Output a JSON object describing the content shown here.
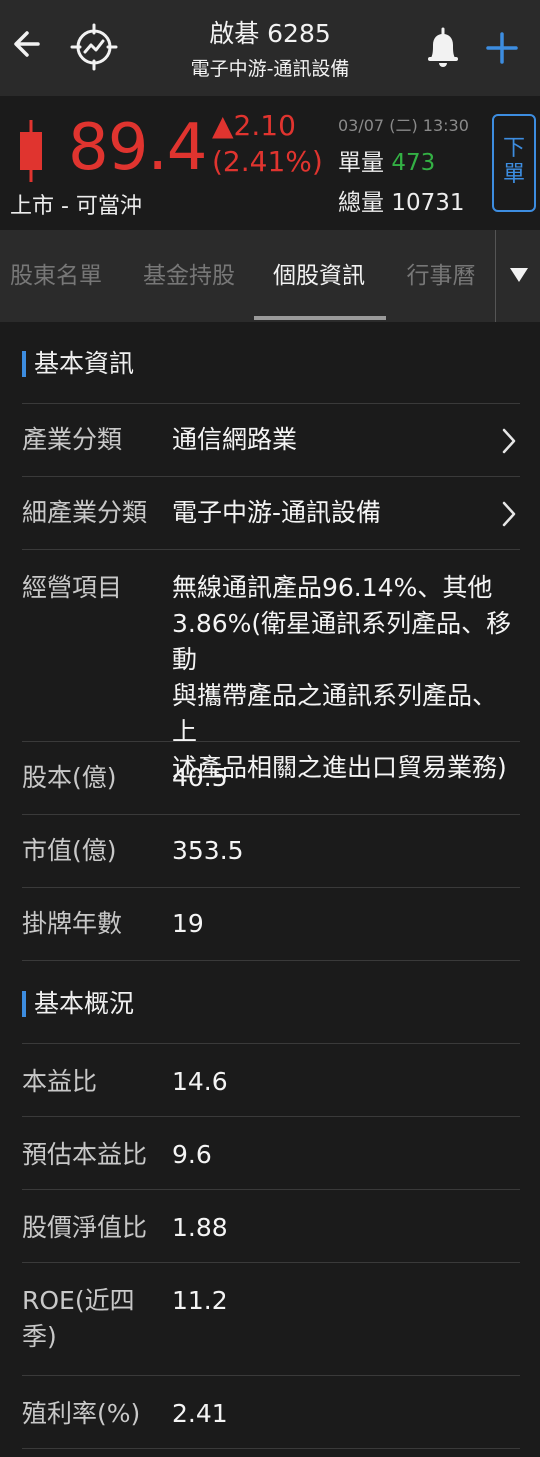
{
  "header": {
    "title": "啟碁 6285",
    "subtitle": "電子中游-通訊設備"
  },
  "quote": {
    "price": "89.4",
    "change": "▲2.10",
    "change_pct": "(2.41%)",
    "status": "上市 - 可當沖",
    "datetime": "03/07 (二) 13:30",
    "single_label": "單量",
    "single_value": "473",
    "total_label": "總量",
    "total_value": "10731",
    "order_button": "下單"
  },
  "tabs": [
    {
      "label": "股東名單"
    },
    {
      "label": "基金持股"
    },
    {
      "label": "個股資訊"
    },
    {
      "label": "行事曆"
    }
  ],
  "active_tab": "個股資訊",
  "sections": {
    "basic_info": {
      "title": "基本資訊",
      "industry": {
        "label": "產業分類",
        "value": "通信網路業"
      },
      "sub_industry": {
        "label": "細產業分類",
        "value": "電子中游-通訊設備"
      },
      "business": {
        "label": "經營項目",
        "lines": [
          "無線通訊產品96.14%、其他",
          "3.86%(衛星通訊系列產品、移動",
          "與攜帶產品之通訊系列產品、上",
          "述產品相關之進出口貿易業務)"
        ]
      },
      "capital": {
        "label": "股本(億)",
        "value": "40.5"
      },
      "market_cap": {
        "label": "市值(億)",
        "value": "353.5"
      },
      "listed_years": {
        "label": "掛牌年數",
        "value": "19"
      }
    },
    "overview": {
      "title": "基本概況",
      "pe": {
        "label": "本益比",
        "value": "14.6"
      },
      "forward_pe": {
        "label": "預估本益比",
        "value": "9.6"
      },
      "pb": {
        "label": "股價淨值比",
        "value": "1.88"
      },
      "roe": {
        "label_lines": [
          "ROE(近四",
          "季)"
        ],
        "value": "11.2"
      },
      "yield": {
        "label": "殖利率(%)",
        "value": "2.41"
      }
    }
  },
  "colors": {
    "up": "#e0342f",
    "accent": "#3d8de0",
    "green": "#33b044"
  },
  "icons": [
    "back-arrow-icon",
    "chart-icon",
    "bell-icon",
    "plus-icon",
    "candlestick-icon",
    "chevron-right-icon",
    "dropdown-triangle-icon"
  ]
}
